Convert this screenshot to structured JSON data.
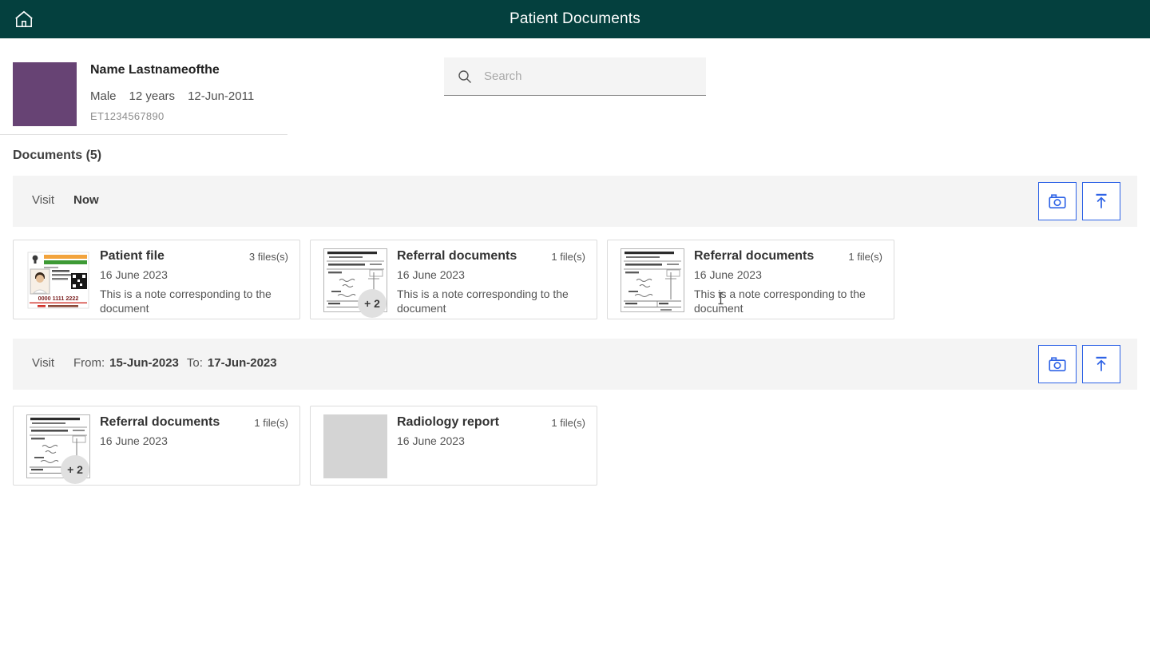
{
  "header": {
    "title": "Patient Documents"
  },
  "patient": {
    "name": "Name Lastnameofthe",
    "sex": "Male",
    "age": "12 years",
    "dob": "12-Jun-2011",
    "id": "ET1234567890"
  },
  "search": {
    "placeholder": "Search"
  },
  "section": {
    "heading": "Documents (5)"
  },
  "visits": [
    {
      "label": "Visit",
      "value": "Now",
      "cards": [
        {
          "title": "Patient file",
          "files": "3 files(s)",
          "date": "16 June 2023",
          "note": "This is a note corresponding to the document"
        },
        {
          "title": "Referral documents",
          "files": "1 file(s)",
          "date": "16 June 2023",
          "note": "This is a note corresponding to the document",
          "badge": "+ 2"
        },
        {
          "title": "Referral documents",
          "files": "1 file(s)",
          "date": "16 June 2023",
          "note": "This is a note corresponding to the document"
        }
      ]
    },
    {
      "label": "Visit",
      "from_label": "From:",
      "from": "15-Jun-2023",
      "to_label": "To:",
      "to": "17-Jun-2023",
      "cards": [
        {
          "title": "Referral documents",
          "files": "1 file(s)",
          "date": "16 June 2023",
          "badge": "+ 2"
        },
        {
          "title": "Radiology report",
          "files": "1 file(s)",
          "date": "16 June 2023"
        }
      ]
    }
  ],
  "id_card_thumb": {
    "number": "0000 1111 2222"
  },
  "colors": {
    "header_bg": "#04403e",
    "accent_blue": "#2e63e6",
    "avatar_purple": "#674374",
    "visit_row_bg": "#f4f4f4"
  }
}
